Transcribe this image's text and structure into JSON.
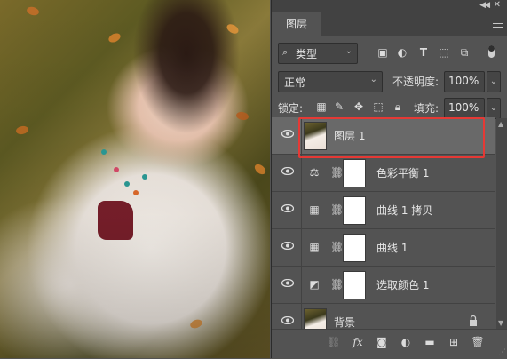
{
  "panel": {
    "tab_label": "图层",
    "filter": {
      "label": "类型",
      "search_icon": "search-icon"
    },
    "blend_mode": "正常",
    "opacity_label": "不透明度:",
    "opacity_value": "100%",
    "lock_label": "锁定:",
    "fill_label": "填充:",
    "fill_value": "100%"
  },
  "layers": [
    {
      "name": "图层 1",
      "selected": true,
      "type": "pixel"
    },
    {
      "name": "色彩平衡 1",
      "selected": false,
      "type": "adjustment-color-balance"
    },
    {
      "name": "曲线 1 拷贝",
      "selected": false,
      "type": "adjustment-curves"
    },
    {
      "name": "曲线 1",
      "selected": false,
      "type": "adjustment-curves"
    },
    {
      "name": "选取颜色 1",
      "selected": false,
      "type": "adjustment-selective-color"
    },
    {
      "name": "背景",
      "selected": false,
      "type": "background",
      "locked": true
    }
  ],
  "colors": {
    "panel_bg": "#535353",
    "selected_row": "#696969",
    "highlight_box": "#e53935"
  }
}
